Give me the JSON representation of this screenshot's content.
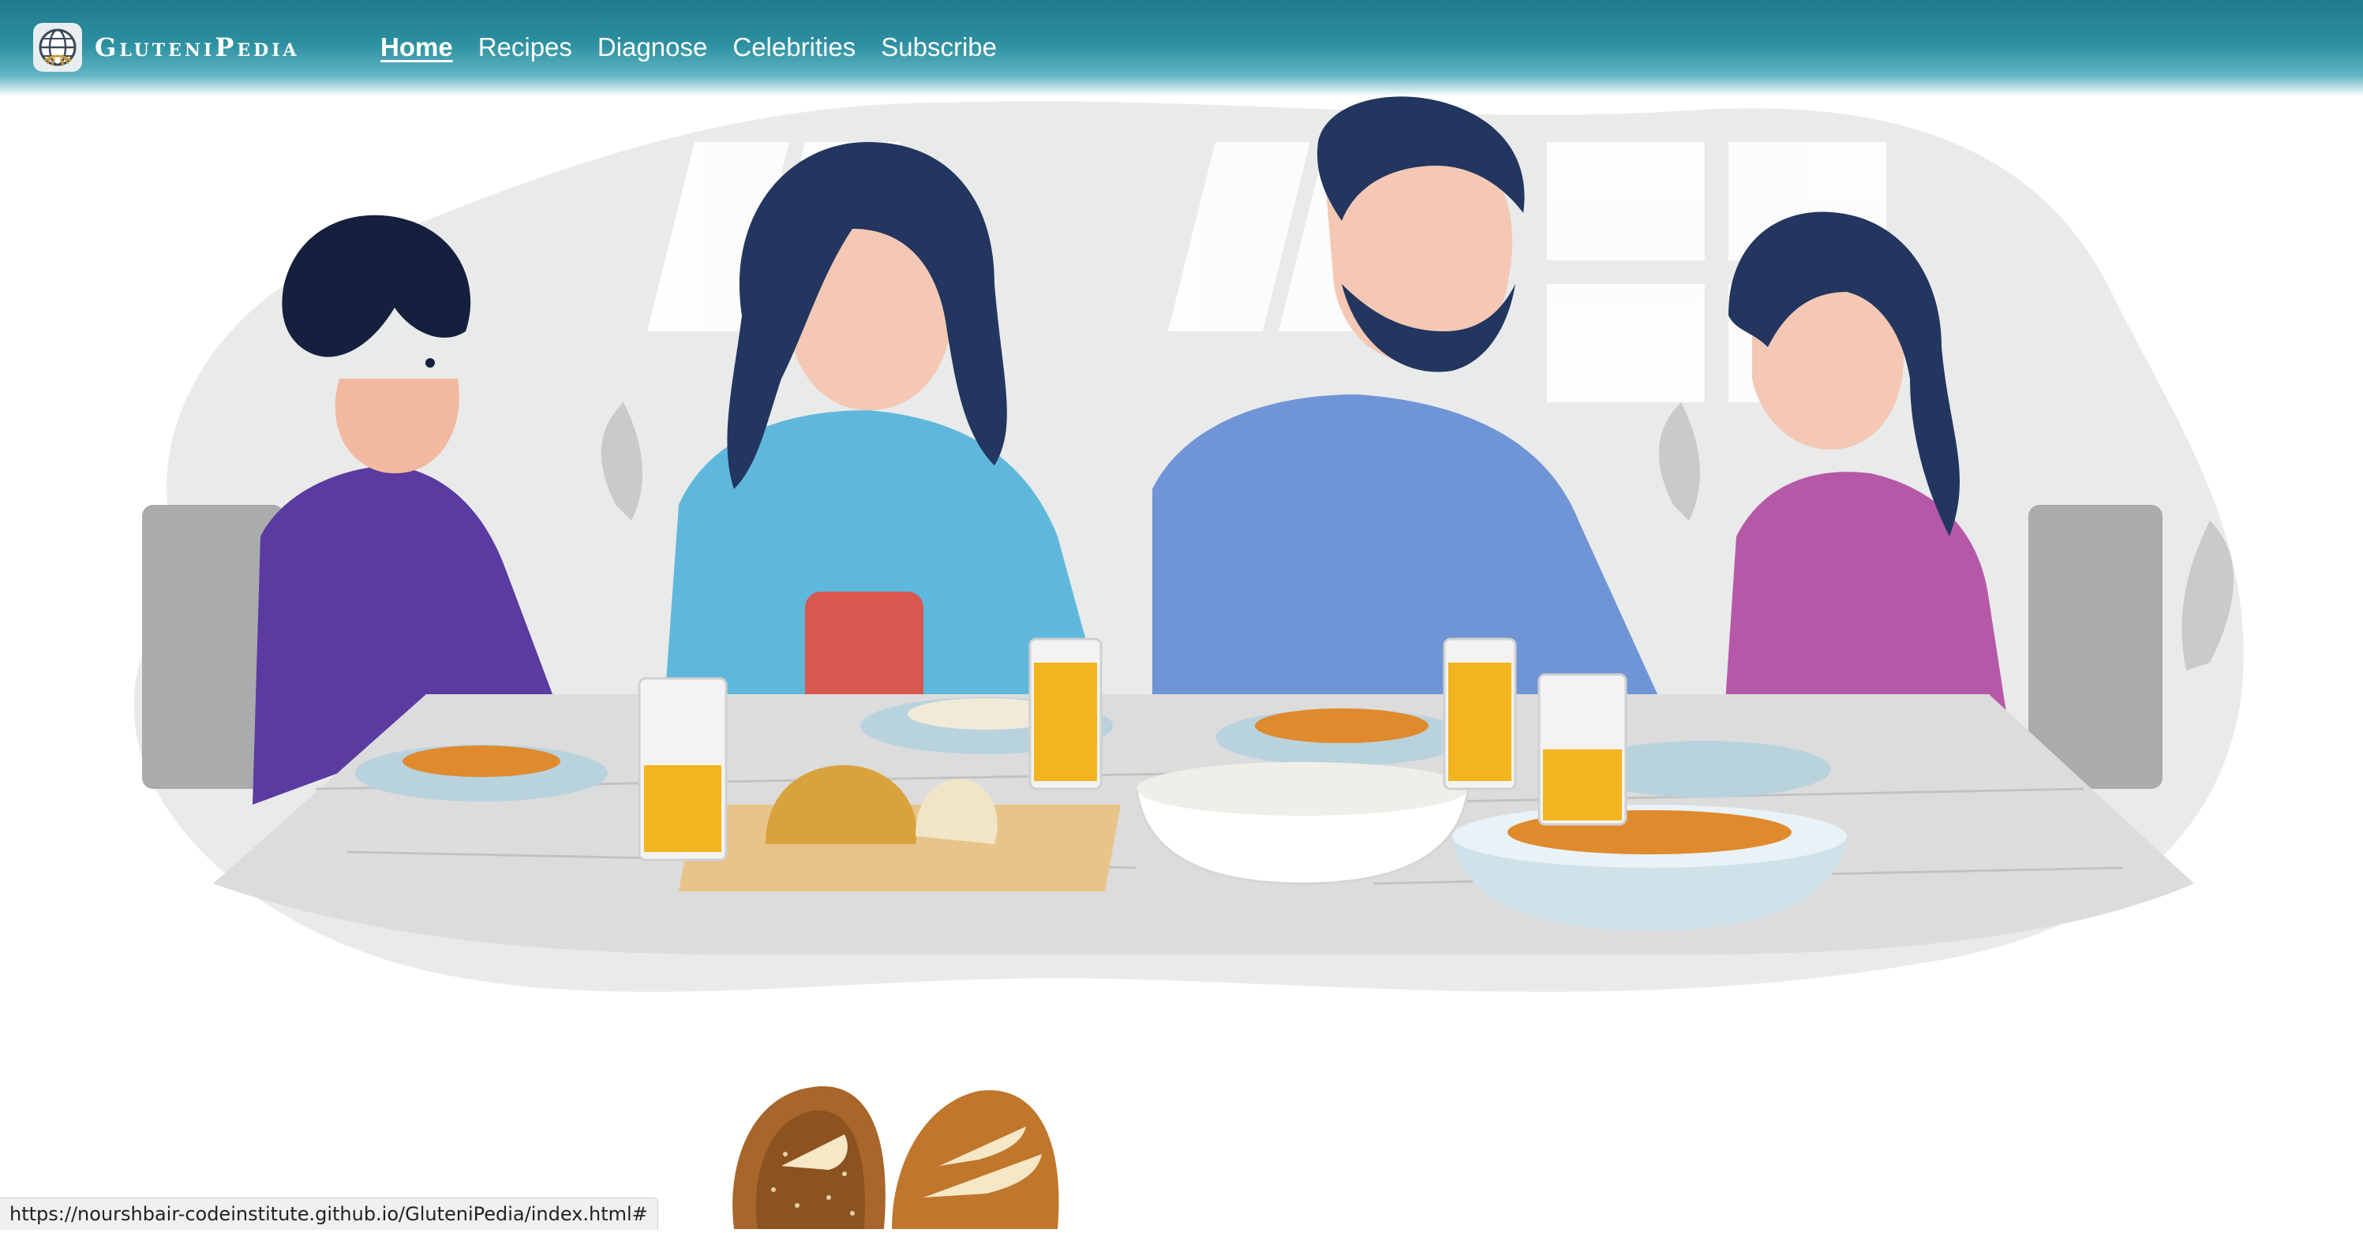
{
  "brand": {
    "name": "GluteniPedia",
    "logo_icon": "globe-wheat-logo-icon"
  },
  "nav": {
    "items": [
      {
        "label": "Home",
        "active": true
      },
      {
        "label": "Recipes",
        "active": false
      },
      {
        "label": "Diagnose",
        "active": false
      },
      {
        "label": "Celebrities",
        "active": false
      },
      {
        "label": "Subscribe",
        "active": false
      }
    ]
  },
  "hero": {
    "illustration": "family-dinner-illustration",
    "people": [
      "boy-purple-shirt",
      "woman-teal-shirt",
      "man-blue-shirt",
      "girl-pink-shirt"
    ]
  },
  "section": {
    "illustration": "bread-loaves-illustration"
  },
  "status_bar": {
    "url": "https://nourshbair-codeinstitute.github.io/GluteniPedia/index.html#"
  },
  "colors": {
    "navbar": "#2c8fa0",
    "nav_text": "#ffffff",
    "status_bg": "#f0f0f0"
  }
}
